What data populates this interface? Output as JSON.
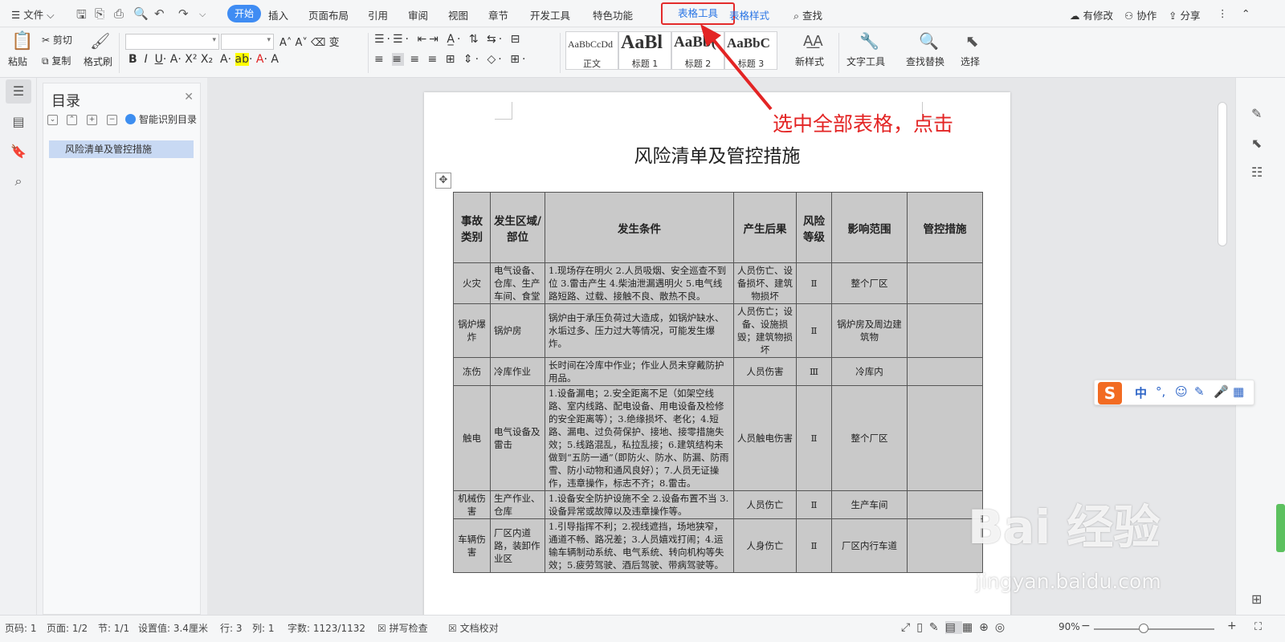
{
  "menubar": {
    "file": "文件",
    "tabs": [
      "开始",
      "插入",
      "页面布局",
      "引用",
      "审阅",
      "视图",
      "章节",
      "开发工具",
      "特色功能",
      "表格工具",
      "表格样式"
    ],
    "search": "查找",
    "modified": "有修改",
    "collab": "协作",
    "share": "分享"
  },
  "ribbon": {
    "paste": "粘贴",
    "cut": "剪切",
    "copy": "复制",
    "format_painter": "格式刷",
    "styles": [
      {
        "preview": "AaBbCcDd",
        "name": "正文"
      },
      {
        "preview": "AaBl",
        "name": "标题 1"
      },
      {
        "preview": "AaBb(",
        "name": "标题 2"
      },
      {
        "preview": "AaBbC",
        "name": "标题 3"
      }
    ],
    "new_style": "新样式",
    "text_tools": "文字工具",
    "find_replace": "查找替换",
    "select": "选择"
  },
  "toc": {
    "title": "目录",
    "smart": "智能识别目录",
    "items": [
      "风险清单及管控措施"
    ]
  },
  "document": {
    "title": "风险清单及管控措施",
    "headers": [
      "事故类别",
      "发生区域/部位",
      "发生条件",
      "产生后果",
      "风险等级",
      "影响范围",
      "管控措施"
    ],
    "rows": [
      [
        "火灾",
        "电气设备、仓库、生产车间、食堂",
        "1.现场存在明火 2.人员吸烟、安全巡查不到位 3.雷击产生 4.柴油泄漏遇明火 5.电气线路短路、过载、接触不良、散热不良。",
        "人员伤亡、设备损坏、建筑物损坏",
        "Ⅱ",
        "整个厂区",
        ""
      ],
      [
        "锅炉爆炸",
        "锅炉房",
        "锅炉由于承压负荷过大造成，如锅炉缺水、水垢过多、压力过大等情况，可能发生爆炸。",
        "人员伤亡；设备、设施损毁；建筑物损坏",
        "Ⅱ",
        "锅炉房及周边建筑物",
        ""
      ],
      [
        "冻伤",
        "冷库作业",
        "长时间在冷库中作业；作业人员未穿戴防护用品。",
        "人员伤害",
        "Ⅲ",
        "冷库内",
        ""
      ],
      [
        "触电",
        "电气设备及雷击",
        "1.设备漏电；2.安全距离不足（如架空线路、室内线路、配电设备、用电设备及检修的安全距离等）；3.绝缘损坏、老化；4.短路、漏电、过负荷保护、接地、接零措施失效；5.线路混乱，私拉乱接；6.建筑结构未做到“五防一通”（即防火、防水、防漏、防雨雪、防小动物和通风良好）；7.人员无证操作，违章操作，标志不齐；8.雷击。",
        "人员触电伤害",
        "Ⅱ",
        "整个厂区",
        ""
      ],
      [
        "机械伤害",
        "生产作业、仓库",
        "1.设备安全防护设施不全 2.设备布置不当 3.设备异常或故障以及违章操作等。",
        "人员伤亡",
        "Ⅱ",
        "生产车间",
        ""
      ],
      [
        "车辆伤害",
        "厂区内道路，装卸作业区",
        "1.引导指挥不利；2.视线遮挡，场地狭窄，通道不畅、路况差；3.人员嬉戏打闹；4.运输车辆制动系统、电气系统、转向机构等失效；5.疲劳驾驶、酒后驾驶、带病驾驶等。",
        "人身伤亡",
        "Ⅱ",
        "厂区内行车道",
        ""
      ]
    ]
  },
  "annotation": "选中全部表格，点击",
  "statusbar": {
    "page_code": "页码: 1",
    "pages": "页面: 1/2",
    "section": "节: 1/1",
    "setting": "设置值: 3.4厘米",
    "row": "行: 3",
    "col": "列: 1",
    "words": "字数: 1123/1132",
    "spell": "拼写检查",
    "proofread": "文档校对",
    "zoom": "90%"
  },
  "ime": {
    "lang": "中"
  },
  "watermark": {
    "brand": "Bai 经验",
    "url": "jingyan.baidu.com"
  }
}
